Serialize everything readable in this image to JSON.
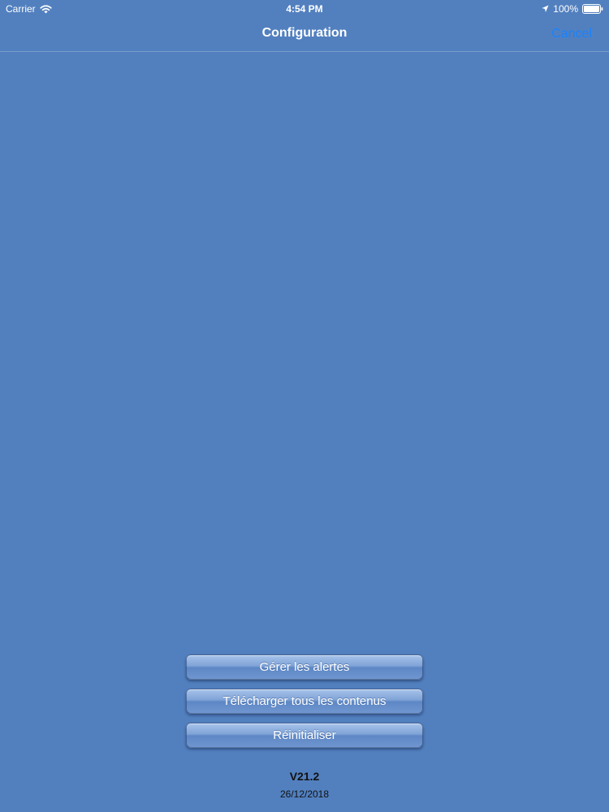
{
  "status_bar": {
    "carrier": "Carrier",
    "time": "4:54 PM",
    "battery": "100%",
    "icons": [
      "wifi-icon",
      "location-icon",
      "battery-icon"
    ]
  },
  "nav": {
    "title": "Configuration",
    "cancel_label": "Cancel"
  },
  "actions": {
    "manage_alerts_label": "Gérer les alertes",
    "download_all_label": "Télécharger tous les contenus",
    "reset_label": "Réinitialiser"
  },
  "footer": {
    "version": "V21.2",
    "date": "26/12/2018"
  },
  "colors": {
    "background": "#5280bf",
    "accent": "#1a82fb"
  }
}
